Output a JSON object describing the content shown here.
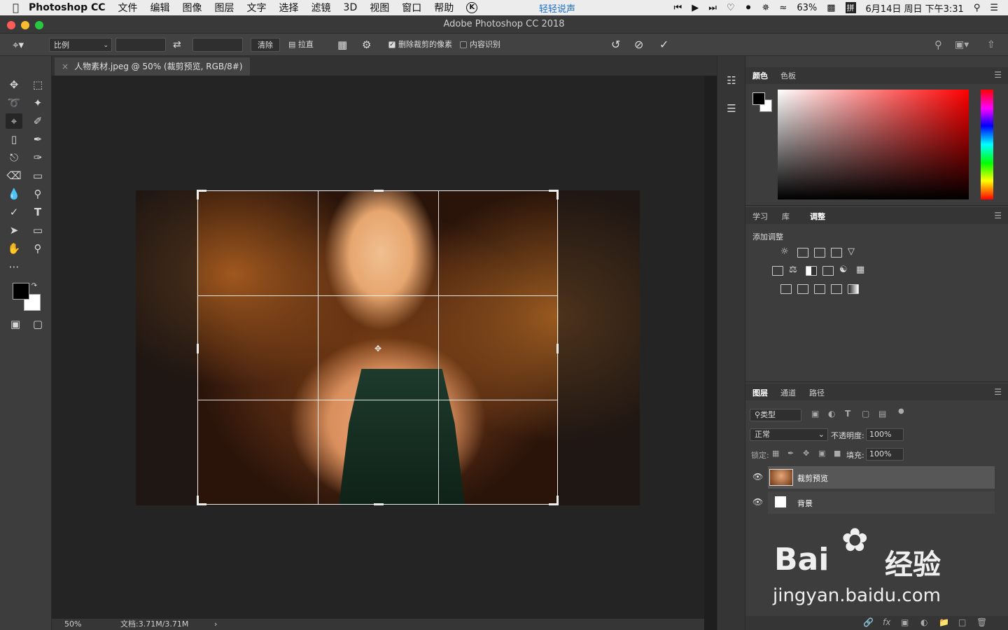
{
  "menubar": {
    "app_name": "Photoshop CC",
    "items": [
      "文件",
      "编辑",
      "图像",
      "图层",
      "文字",
      "选择",
      "滤镜",
      "3D",
      "视图",
      "窗口",
      "帮助"
    ],
    "center_app": "轻轻说声",
    "battery": "63%",
    "datetime": "6月14日 周日 下午3:31"
  },
  "window": {
    "title": "Adobe Photoshop CC 2018"
  },
  "options_bar": {
    "ratio_select": "比例",
    "clear_button": "清除",
    "straighten_label": "拉直",
    "delete_cropped_label": "删除裁剪的像素",
    "delete_cropped_checked": true,
    "content_aware_label": "内容识别",
    "content_aware_checked": false
  },
  "document": {
    "tab_title": "人物素材.jpeg @ 50% (裁剪预览, RGB/8#)"
  },
  "status": {
    "zoom": "50%",
    "doc_size": "文档:3.71M/3.71M"
  },
  "color_panel": {
    "tabs": [
      "颜色",
      "色板"
    ],
    "active": "颜色",
    "foreground": "#000000",
    "background": "#ffffff"
  },
  "adjust_panel": {
    "tabs": [
      "学习",
      "库",
      "调整"
    ],
    "active": "调整",
    "heading": "添加调整"
  },
  "layers_panel": {
    "tabs": [
      "图层",
      "通道",
      "路径"
    ],
    "active": "图层",
    "filter_type": "类型",
    "blend_mode": "正常",
    "opacity_label": "不透明度:",
    "opacity_value": "100%",
    "lock_label": "锁定:",
    "fill_label": "填充:",
    "fill_value": "100%",
    "layers": [
      {
        "name": "裁剪预览",
        "selected": true
      },
      {
        "name": "背景",
        "selected": false
      }
    ]
  },
  "watermark": {
    "brand": "Bai",
    "brand_cn": "经验",
    "url": "jingyan.baidu.com"
  }
}
